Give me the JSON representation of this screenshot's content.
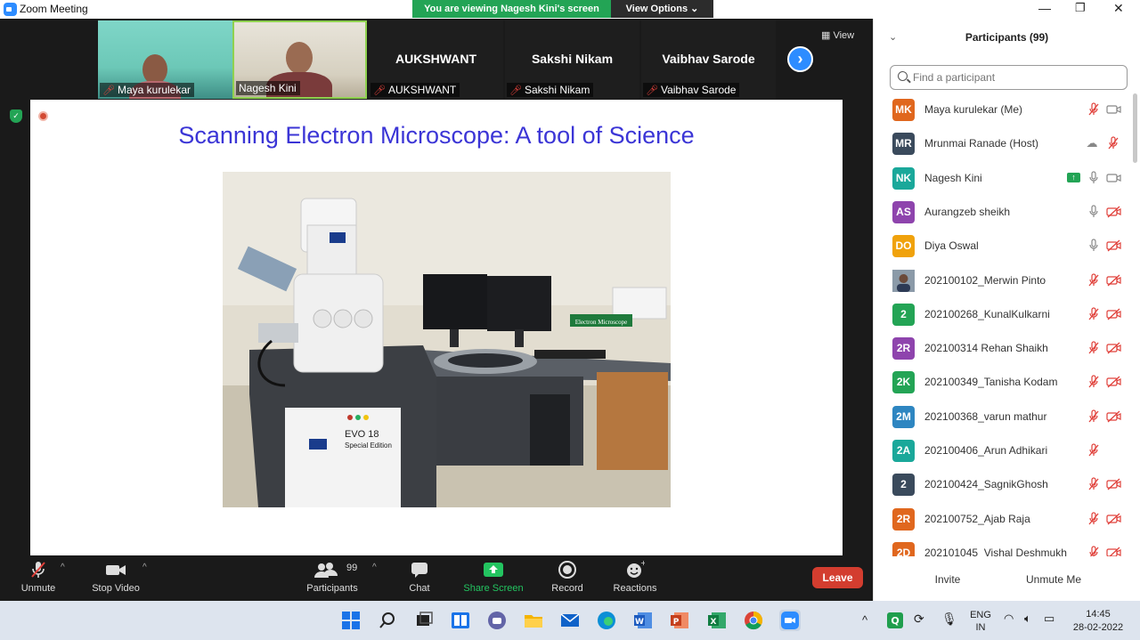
{
  "window": {
    "title": "Zoom Meeting"
  },
  "banner": {
    "viewing": "You are viewing Nagesh Kini's screen",
    "view_options": "View Options ⌄"
  },
  "gallery": {
    "tiles": [
      {
        "name": "Maya kurulekar",
        "big_name": "",
        "muted": true
      },
      {
        "name": "Nagesh Kini",
        "big_name": "",
        "muted": false
      },
      {
        "name": "AUKSHWANT",
        "big_name": "AUKSHWANT",
        "muted": true
      },
      {
        "name": "Sakshi Nikam",
        "big_name": "Sakshi Nikam",
        "muted": true
      },
      {
        "name": "Vaibhav Sarode",
        "big_name": "Vaibhav Sarode",
        "muted": true
      }
    ],
    "view_label": "View"
  },
  "slide": {
    "title": "Scanning Electron Microscope: A tool of Science"
  },
  "toolbar": {
    "unmute": "Unmute",
    "stop_video": "Stop Video",
    "participants": "Participants",
    "participants_count": "99",
    "chat": "Chat",
    "share_screen": "Share Screen",
    "record": "Record",
    "reactions": "Reactions",
    "leave": "Leave"
  },
  "panel": {
    "title": "Participants (99)",
    "search_placeholder": "Find a participant",
    "invite": "Invite",
    "unmute_me": "Unmute Me",
    "participants": [
      {
        "initials": "MK",
        "color": "#e0671e",
        "name": "Maya kurulekar (Me)",
        "mic": "muted",
        "video": "on",
        "extra": ""
      },
      {
        "initials": "MR",
        "color": "#3a4a5c",
        "name": "Mrunmai Ranade (Host)",
        "mic": "muted",
        "video": "",
        "extra": "cloud"
      },
      {
        "initials": "NK",
        "color": "#1aa89a",
        "name": "Nagesh Kini",
        "mic": "on",
        "video": "on",
        "extra": "share"
      },
      {
        "initials": "AS",
        "color": "#8e44ad",
        "name": "Aurangzeb sheikh",
        "mic": "on",
        "video": "off",
        "extra": ""
      },
      {
        "initials": "DO",
        "color": "#f0a20c",
        "name": "Diya Oswal",
        "mic": "on",
        "video": "off",
        "extra": ""
      },
      {
        "initials": "",
        "color": "#9aa6b2",
        "name": "202100102_Merwin Pinto",
        "mic": "muted",
        "video": "off",
        "extra": "photo"
      },
      {
        "initials": "2",
        "color": "#23a455",
        "name": "202100268_KunalKulkarni",
        "mic": "muted",
        "video": "off",
        "extra": ""
      },
      {
        "initials": "2R",
        "color": "#8e44ad",
        "name": "202100314 Rehan Shaikh",
        "mic": "muted",
        "video": "off",
        "extra": ""
      },
      {
        "initials": "2K",
        "color": "#23a455",
        "name": "202100349_Tanisha Kodam",
        "mic": "muted",
        "video": "off",
        "extra": ""
      },
      {
        "initials": "2M",
        "color": "#2e86c1",
        "name": "202100368_varun mathur",
        "mic": "muted",
        "video": "off",
        "extra": ""
      },
      {
        "initials": "2A",
        "color": "#1aa89a",
        "name": "202100406_Arun Adhikari",
        "mic": "muted",
        "video": "",
        "extra": ""
      },
      {
        "initials": "2",
        "color": "#3a4a5c",
        "name": "202100424_SagnikGhosh",
        "mic": "muted",
        "video": "off",
        "extra": ""
      },
      {
        "initials": "2R",
        "color": "#e0671e",
        "name": "202100752_Ajab Raja",
        "mic": "muted",
        "video": "off",
        "extra": ""
      },
      {
        "initials": "2D",
        "color": "#e0671e",
        "name": "202101045_Vishal Deshmukh",
        "mic": "muted",
        "video": "off",
        "extra": ""
      }
    ]
  },
  "taskbar": {
    "lang_top": "ENG",
    "lang_bottom": "IN",
    "time": "14:45",
    "date": "28-02-2022"
  }
}
